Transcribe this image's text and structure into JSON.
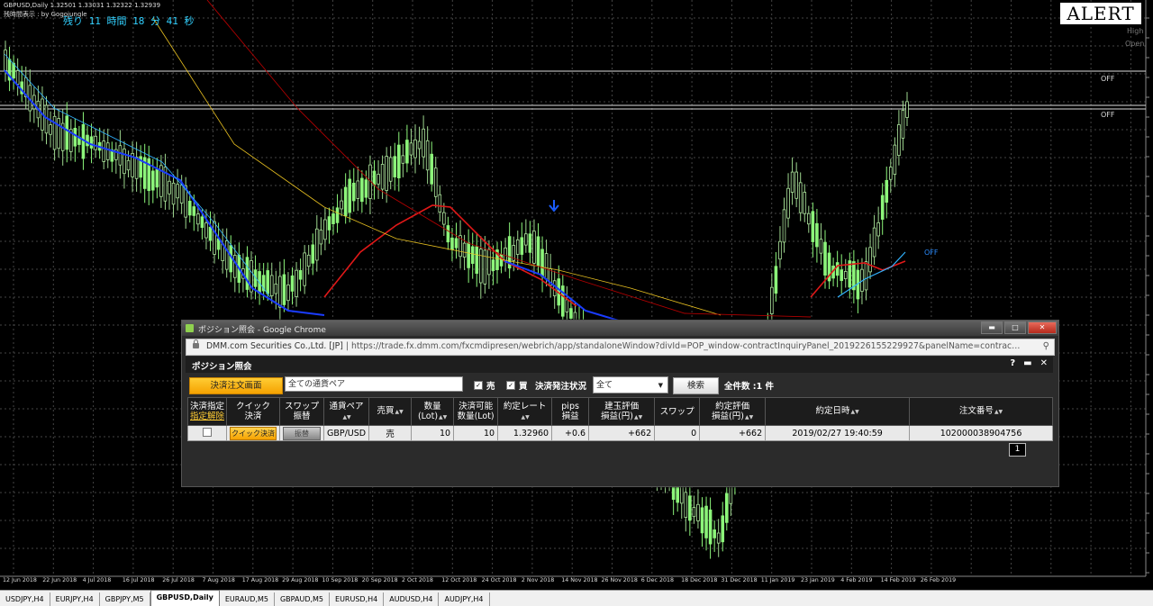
{
  "chart": {
    "title": "GBPUSD,Daily  1.32501 1.33031 1.32322 1.32939",
    "subtitle": "残時間表示 : by Gogojungle",
    "countdown": "残り 11 時間 18 分 41 秒",
    "alert": "ALERT",
    "high_label": "High",
    "open_label": "Open",
    "off_labels": [
      "OFF",
      "OFF",
      "OFF"
    ],
    "colors": {
      "bull": "#8cf57a",
      "bear": "#ffffff",
      "grid": "#444",
      "ma_red": "#e01818",
      "ma_blue": "#1a3cff",
      "ma_yellow": "#e8c020",
      "ma_darkred": "#b00000"
    },
    "x_labels": [
      "12 Jun 2018",
      "22 Jun 2018",
      "4 Jul 2018",
      "16 Jul 2018",
      "26 Jul 2018",
      "7 Aug 2018",
      "17 Aug 2018",
      "29 Aug 2018",
      "10 Sep 2018",
      "20 Sep 2018",
      "2 Oct 2018",
      "12 Oct 2018",
      "24 Oct 2018",
      "2 Nov 2018",
      "14 Nov 2018",
      "26 Nov 2018",
      "6 Dec 2018",
      "18 Dec 2018",
      "31 Dec 2018",
      "11 Jan 2019",
      "23 Jan 2019",
      "4 Feb 2019",
      "14 Feb 2019",
      "26 Feb 2019"
    ]
  },
  "tabs": [
    "USDJPY,H4",
    "EURJPY,H4",
    "GBPJPY,M5",
    "GBPUSD,Daily",
    "EURAUD,M5",
    "GBPAUD,M5",
    "EURUSD,H4",
    "AUDUSD,H4",
    "AUDJPY,H4"
  ],
  "active_tab": "GBPUSD,Daily",
  "window": {
    "title": "ポジション照会 - Google Chrome",
    "url_host": "DMM.com Securities Co.,Ltd. [JP]",
    "url": "https://trade.fx.dmm.com/fxcmdipresen/webrich/app/standaloneWindow?divId=POP_window-contractInquiryPanel_2019226155229927&panelName=contrac…",
    "panel_title": "ポジション照会",
    "panel_icons": [
      "?",
      "▬",
      "✕"
    ]
  },
  "toolbar": {
    "order_button": "決済注文画面",
    "pair_placeholder": "全ての通貨ペア",
    "sell_label": "売",
    "buy_label": "買",
    "status_label": "決済発注状況",
    "status_value": "全て",
    "search_button": "検索",
    "count": "全件数 :1 件"
  },
  "table": {
    "headers": {
      "designate": "決済指定",
      "designate_clear": "指定解除",
      "quick": "クイック\n決済",
      "swap_transfer": "スワップ\n振替",
      "pair": "通貨ペア",
      "side": "売買",
      "qty": "数量\n(Lot)",
      "closable": "決済可能\n数量(Lot)",
      "rate": "約定レート",
      "pips": "pips\n損益",
      "unrealized": "建玉評価\n損益(円)",
      "swap": "スワップ",
      "total": "約定評価\n損益(円)",
      "datetime": "約定日時",
      "order_no": "注文番号"
    },
    "rows": [
      {
        "quick_btn": "クイック決済",
        "swap_btn": "振替",
        "pair": "GBP/USD",
        "side": "売",
        "qty": "10",
        "closable": "10",
        "rate": "1.32960",
        "pips": "+0.6",
        "unrealized": "+662",
        "swap": "0",
        "total": "+662",
        "datetime": "2019/02/27 19:40:59",
        "order_no": "102000038904756"
      }
    ],
    "page": "1"
  }
}
